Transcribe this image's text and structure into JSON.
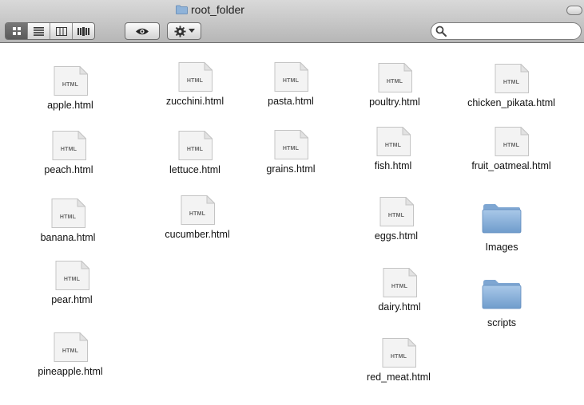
{
  "window": {
    "title": "root_folder"
  },
  "toolbar": {
    "view_buttons": [
      "icon-view",
      "list-view",
      "column-view",
      "coverflow-view"
    ],
    "search_placeholder": ""
  },
  "items": [
    {
      "name": "apple.html",
      "kind": "html"
    },
    {
      "name": "zucchini.html",
      "kind": "html"
    },
    {
      "name": "pasta.html",
      "kind": "html"
    },
    {
      "name": "poultry.html",
      "kind": "html"
    },
    {
      "name": "chicken_pikata.html",
      "kind": "html"
    },
    {
      "name": "peach.html",
      "kind": "html"
    },
    {
      "name": "lettuce.html",
      "kind": "html"
    },
    {
      "name": "grains.html",
      "kind": "html"
    },
    {
      "name": "fish.html",
      "kind": "html"
    },
    {
      "name": "fruit_oatmeal.html",
      "kind": "html"
    },
    {
      "name": "banana.html",
      "kind": "html"
    },
    {
      "name": "cucumber.html",
      "kind": "html"
    },
    {
      "name": "eggs.html",
      "kind": "html"
    },
    {
      "name": "Images",
      "kind": "folder"
    },
    {
      "name": "pear.html",
      "kind": "html"
    },
    {
      "name": "dairy.html",
      "kind": "html"
    },
    {
      "name": "scripts",
      "kind": "folder"
    },
    {
      "name": "pineapple.html",
      "kind": "html"
    },
    {
      "name": "red_meat.html",
      "kind": "html"
    }
  ],
  "doc_badge": "HTML",
  "colors": {
    "folder": "#8fb3d9",
    "toolbar_top": "#d9d9d9",
    "toolbar_bottom": "#b6b6b6"
  }
}
